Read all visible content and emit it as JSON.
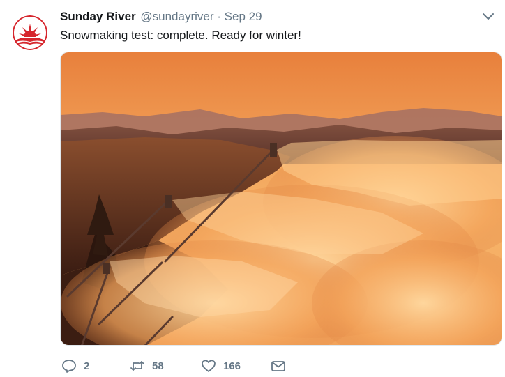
{
  "tweet": {
    "author_name": "Sunday River",
    "author_handle": "@sundayriver",
    "separator": "·",
    "date": "Sep 29",
    "text": "Snowmaking test: complete. Ready for winter!",
    "media_alt": "Snow guns spraying mist at sunset over mountains",
    "actions": {
      "reply_count": "2",
      "retweet_count": "58",
      "like_count": "166"
    }
  },
  "colors": {
    "brand_red": "#d6262d",
    "text_primary": "#14171a",
    "text_secondary": "#657786"
  },
  "icons": {
    "avatar": "sunday-river-logo",
    "caret": "chevron-down-icon",
    "reply": "reply-icon",
    "retweet": "retweet-icon",
    "like": "heart-icon",
    "dm": "envelope-icon"
  }
}
